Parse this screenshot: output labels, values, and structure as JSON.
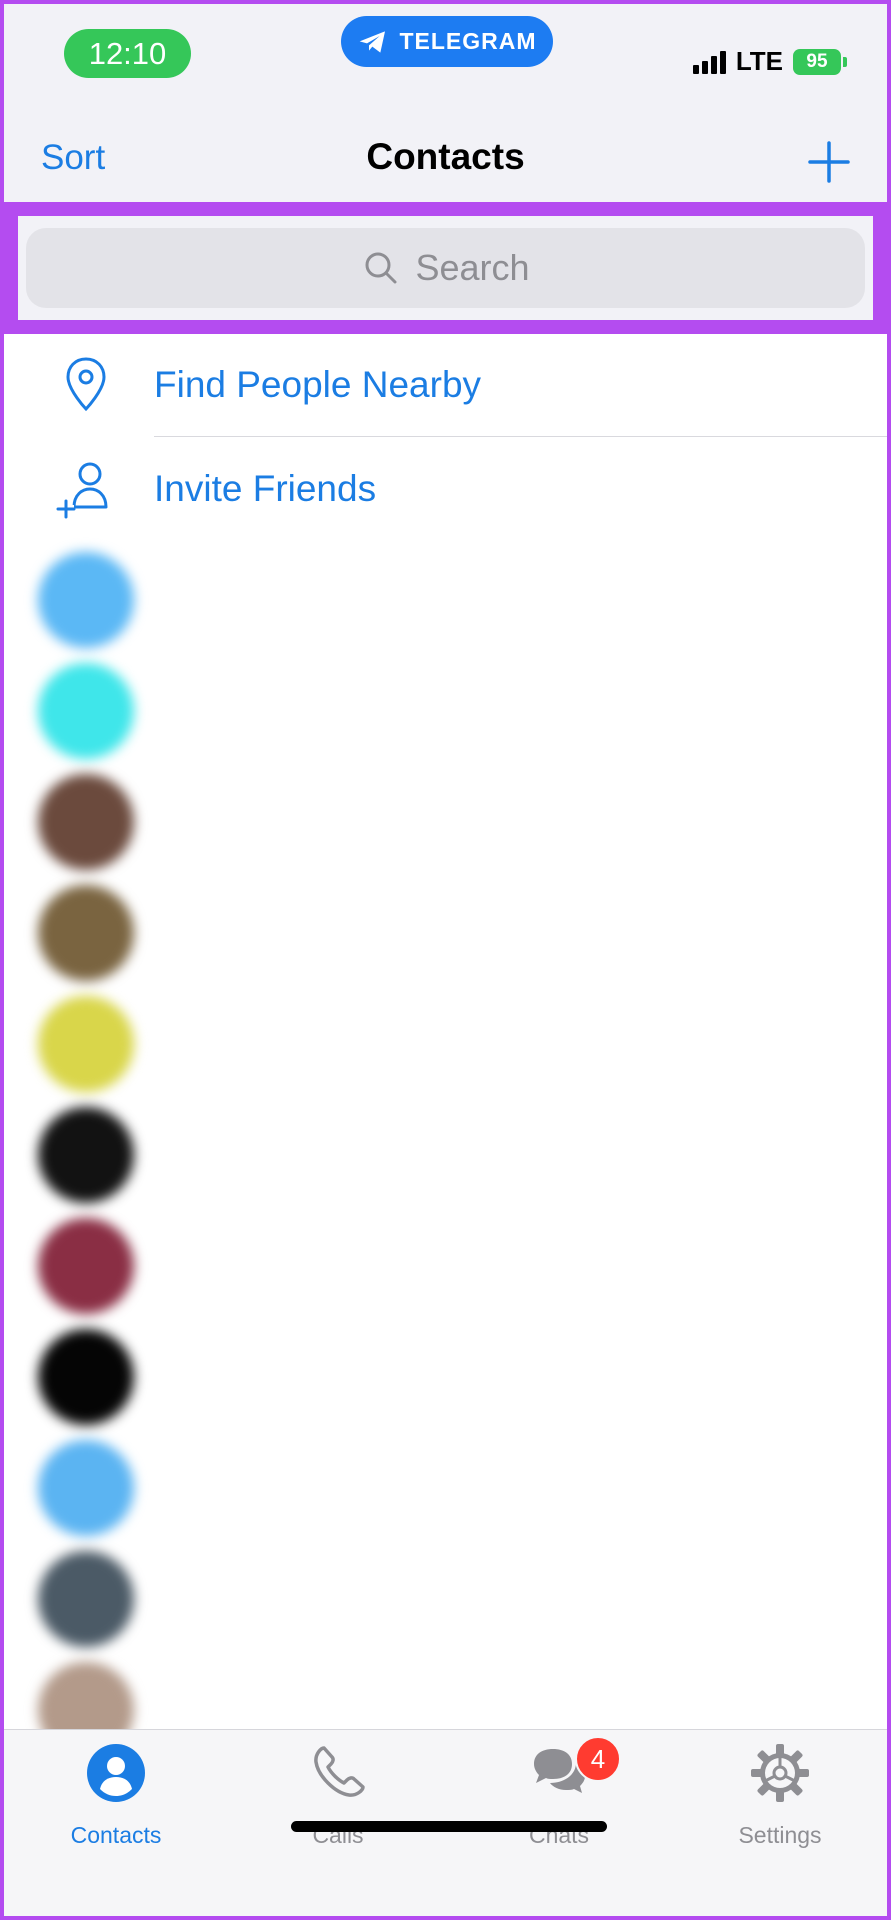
{
  "status_bar": {
    "time": "12:10",
    "app_pill_label": "TELEGRAM",
    "network": "LTE",
    "battery": "95"
  },
  "nav": {
    "sort_label": "Sort",
    "title": "Contacts",
    "add_icon": "plus-icon"
  },
  "search": {
    "placeholder": "Search"
  },
  "actions": [
    {
      "label": "Find People Nearby",
      "icon": "location-pin-icon"
    },
    {
      "label": "Invite Friends",
      "icon": "add-person-icon"
    }
  ],
  "contacts": [
    {
      "name": "",
      "subtitle": "",
      "avatar_color": "#5bb8f5"
    },
    {
      "name": "",
      "subtitle": "",
      "avatar_color": "#3fe6ea"
    },
    {
      "name": "",
      "subtitle": "",
      "avatar_color": "#6b4a3d"
    },
    {
      "name": "",
      "subtitle": "",
      "avatar_color": "#7a6440"
    },
    {
      "name": "",
      "subtitle": "",
      "avatar_color": "#d9d64a"
    },
    {
      "name": "",
      "subtitle": "",
      "avatar_color": "#121212"
    },
    {
      "name": "",
      "subtitle": "",
      "avatar_color": "#8a2e44"
    },
    {
      "name": "",
      "subtitle": "",
      "avatar_color": "#050505"
    },
    {
      "name": "",
      "subtitle": "",
      "avatar_color": "#5bb4f2"
    },
    {
      "name": "",
      "subtitle": "",
      "avatar_color": "#4b5a66"
    },
    {
      "name": "",
      "subtitle": "",
      "avatar_color": "#b39a8a"
    }
  ],
  "tabs": [
    {
      "label": "Contacts",
      "icon": "person-circle-icon",
      "active": true
    },
    {
      "label": "Calls",
      "icon": "phone-icon",
      "active": false
    },
    {
      "label": "Chats",
      "icon": "chat-bubbles-icon",
      "active": false,
      "badge": "4"
    },
    {
      "label": "Settings",
      "icon": "gear-icon",
      "active": false
    }
  ],
  "colors": {
    "accent": "#1b7de3",
    "highlight_border": "#b44cf0",
    "status_green": "#35c759",
    "badge_red": "#ff3b30"
  }
}
